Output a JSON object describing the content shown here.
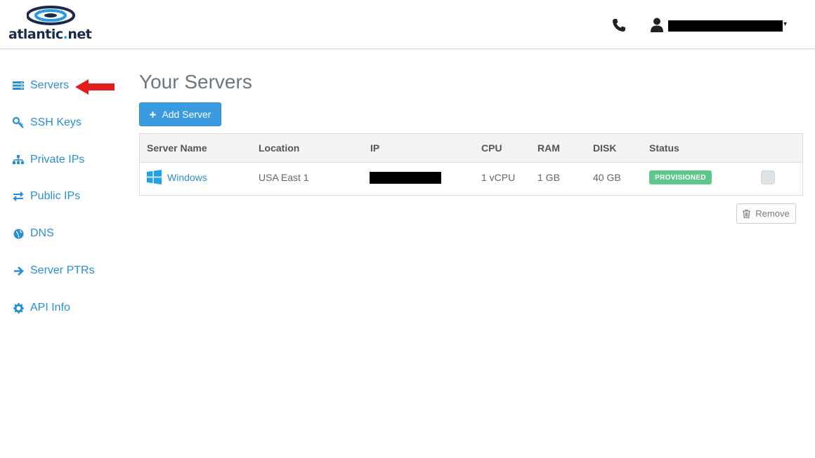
{
  "brand": {
    "logo_text": "atlantic",
    "logo_dot": ".",
    "logo_suffix": "net",
    "accent": "#2a8fd0"
  },
  "header": {
    "user_caret": "▾"
  },
  "sidebar": {
    "items": [
      {
        "label": "Servers",
        "icon": "server-icon"
      },
      {
        "label": "SSH Keys",
        "icon": "key-icon"
      },
      {
        "label": "Private IPs",
        "icon": "sitemap-icon"
      },
      {
        "label": "Public IPs",
        "icon": "exchange-icon"
      },
      {
        "label": "DNS",
        "icon": "globe-icon"
      },
      {
        "label": "Server PTRs",
        "icon": "arrow-right-icon"
      },
      {
        "label": "API Info",
        "icon": "gear-icon"
      }
    ]
  },
  "main": {
    "title": "Your Servers",
    "add_button": {
      "icon": "+",
      "label": "Add Server"
    },
    "table": {
      "columns": [
        "Server Name",
        "Location",
        "IP",
        "CPU",
        "RAM",
        "DISK",
        "Status"
      ],
      "rows": [
        {
          "name": "Windows",
          "location": "USA East 1",
          "cpu": "1 vCPU",
          "ram": "1 GB",
          "disk": "40 GB",
          "status": "PROVISIONED",
          "status_color": "#5cc98b"
        }
      ]
    },
    "remove_button": {
      "label": "Remove"
    }
  }
}
